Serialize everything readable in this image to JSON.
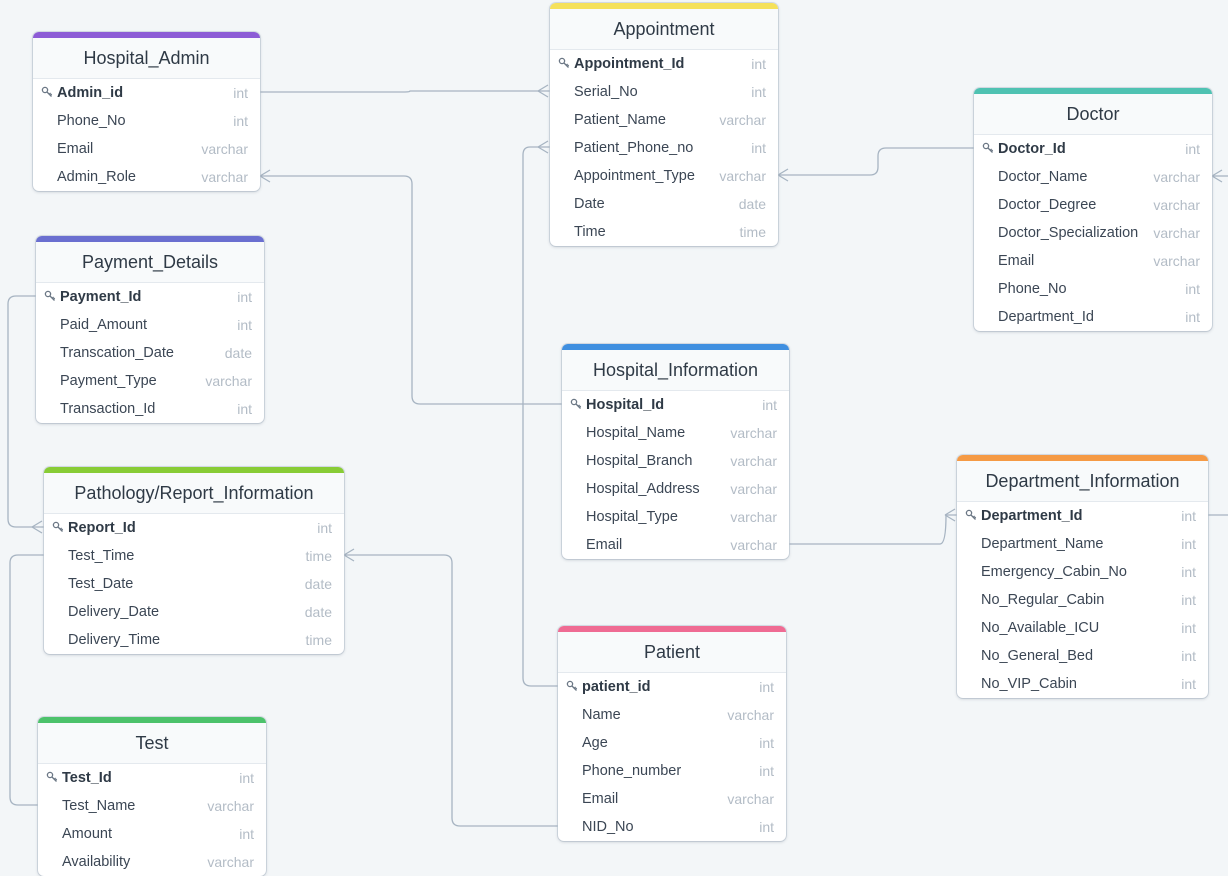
{
  "tables": [
    {
      "id": "hospital_admin",
      "name": "Hospital_Admin",
      "color": "#8d5cd6",
      "fields": [
        {
          "name": "Admin_id",
          "type": "int",
          "pk": true
        },
        {
          "name": "Phone_No",
          "type": "int"
        },
        {
          "name": "Email",
          "type": "varchar"
        },
        {
          "name": "Admin_Role",
          "type": "varchar"
        }
      ]
    },
    {
      "id": "appointment",
      "name": "Appointment",
      "color": "#f5e15a",
      "fields": [
        {
          "name": "Appointment_Id",
          "type": "int",
          "pk": true
        },
        {
          "name": "Serial_No",
          "type": "int"
        },
        {
          "name": "Patient_Name",
          "type": "varchar"
        },
        {
          "name": "Patient_Phone_no",
          "type": "int"
        },
        {
          "name": "Appointment_Type",
          "type": "varchar"
        },
        {
          "name": "Date",
          "type": "date"
        },
        {
          "name": "Time",
          "type": "time"
        }
      ]
    },
    {
      "id": "doctor",
      "name": "Doctor",
      "color": "#4fc2b2",
      "fields": [
        {
          "name": "Doctor_Id",
          "type": "int",
          "pk": true
        },
        {
          "name": "Doctor_Name",
          "type": "varchar"
        },
        {
          "name": "Doctor_Degree",
          "type": "varchar"
        },
        {
          "name": "Doctor_Specialization",
          "type": "varchar"
        },
        {
          "name": "Email",
          "type": "varchar"
        },
        {
          "name": "Phone_No",
          "type": "int"
        },
        {
          "name": "Department_Id",
          "type": "int"
        }
      ]
    },
    {
      "id": "payment_details",
      "name": "Payment_Details",
      "color": "#6a6fd0",
      "fields": [
        {
          "name": "Payment_Id",
          "type": "int",
          "pk": true
        },
        {
          "name": "Paid_Amount",
          "type": "int"
        },
        {
          "name": "Transcation_Date",
          "type": "date"
        },
        {
          "name": "Payment_Type",
          "type": "varchar"
        },
        {
          "name": "Transaction_Id",
          "type": "int"
        }
      ]
    },
    {
      "id": "hospital_information",
      "name": "Hospital_Information",
      "color": "#3f8fe0",
      "fields": [
        {
          "name": "Hospital_Id",
          "type": "int",
          "pk": true
        },
        {
          "name": "Hospital_Name",
          "type": "varchar"
        },
        {
          "name": "Hospital_Branch",
          "type": "varchar"
        },
        {
          "name": "Hospital_Address",
          "type": "varchar"
        },
        {
          "name": "Hospital_Type",
          "type": "varchar"
        },
        {
          "name": "Email",
          "type": "varchar"
        }
      ]
    },
    {
      "id": "pathology_report",
      "name": "Pathology/Report_Information",
      "color": "#88cc36",
      "fields": [
        {
          "name": "Report_Id",
          "type": "int",
          "pk": true
        },
        {
          "name": "Test_Time",
          "type": "time"
        },
        {
          "name": "Test_Date",
          "type": "date"
        },
        {
          "name": "Delivery_Date",
          "type": "date"
        },
        {
          "name": "Delivery_Time",
          "type": "time"
        }
      ]
    },
    {
      "id": "department_information",
      "name": "Department_Information",
      "color": "#f59a45",
      "fields": [
        {
          "name": "Department_Id",
          "type": "int",
          "pk": true
        },
        {
          "name": "Department_Name",
          "type": "int"
        },
        {
          "name": "Emergency_Cabin_No",
          "type": "int"
        },
        {
          "name": "No_Regular_Cabin",
          "type": "int"
        },
        {
          "name": "No_Available_ICU",
          "type": "int"
        },
        {
          "name": "No_General_Bed",
          "type": "int"
        },
        {
          "name": "No_VIP_Cabin",
          "type": "int"
        }
      ]
    },
    {
      "id": "patient",
      "name": "Patient",
      "color": "#ef6b93",
      "fields": [
        {
          "name": "patient_id",
          "type": "int",
          "pk": true
        },
        {
          "name": "Name",
          "type": "varchar"
        },
        {
          "name": "Age",
          "type": "int"
        },
        {
          "name": "Phone_number",
          "type": "int"
        },
        {
          "name": "Email",
          "type": "varchar"
        },
        {
          "name": "NID_No",
          "type": "int"
        }
      ]
    },
    {
      "id": "test",
      "name": "Test",
      "color": "#4cc26b",
      "fields": [
        {
          "name": "Test_Id",
          "type": "int",
          "pk": true
        },
        {
          "name": "Test_Name",
          "type": "varchar"
        },
        {
          "name": "Amount",
          "type": "int"
        },
        {
          "name": "Availability",
          "type": "varchar"
        }
      ]
    }
  ],
  "key_icon": "key-icon"
}
